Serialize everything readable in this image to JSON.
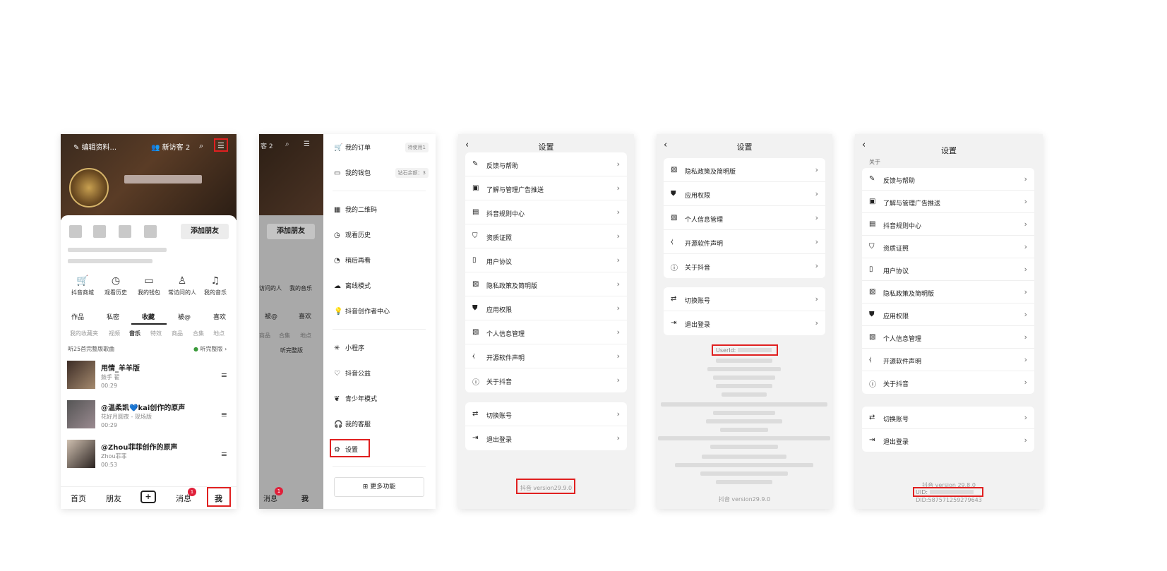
{
  "panel1": {
    "edit_profile": "编辑资料...",
    "new_visitors": "新访客 2",
    "add_friend": "添加朋友",
    "quick": [
      {
        "icon": "cart-icon",
        "label": "抖音商城"
      },
      {
        "icon": "clock-icon",
        "label": "观看历史"
      },
      {
        "icon": "wallet-icon",
        "label": "我的钱包"
      },
      {
        "icon": "person-icon",
        "label": "常访问的人"
      },
      {
        "icon": "music-icon",
        "label": "我的音乐"
      }
    ],
    "tabs": [
      "作品",
      "私密",
      "收藏",
      "被@",
      "喜欢"
    ],
    "subtabs": [
      "我的收藏夹",
      "视频",
      "音乐",
      "特效",
      "商品",
      "合集",
      "地点"
    ],
    "listen_text": "听25首完整版歌曲",
    "listen_full": "听完整版",
    "songs": [
      {
        "title": "用情_羊羊版",
        "artist": "鼓手 翟",
        "dur": "00:29"
      },
      {
        "title": "@温柔凯💙kai创作的原声",
        "artist": "花好月圆夜 - 现场版",
        "dur": "00:29"
      },
      {
        "title": "@Zhou菲菲创作的原声",
        "artist": "Zhou菲菲",
        "dur": "00:53"
      }
    ],
    "nav": [
      "首页",
      "朋友",
      "+",
      "消息",
      "我"
    ],
    "badge": "1"
  },
  "panel2": {
    "top_left": "客 2",
    "add_friend": "添加朋友",
    "quick": [
      "访问的人",
      "我的音乐"
    ],
    "tabs": [
      "被@",
      "喜欢"
    ],
    "subtabs": [
      "商品",
      "合集",
      "地点"
    ],
    "listen_full": "听完整版",
    "nav": [
      "消息",
      "我"
    ],
    "badge": "1",
    "items": [
      {
        "icon": "cart-icon",
        "label": "我的订单",
        "pill": "待使用1"
      },
      {
        "icon": "wallet-icon",
        "label": "我的钱包",
        "pill": "钻石余额：3"
      },
      {
        "icon": "qrcode-icon",
        "label": "我的二维码"
      },
      {
        "icon": "clock-icon",
        "label": "观看历史"
      },
      {
        "icon": "later-icon",
        "label": "稍后再看"
      },
      {
        "icon": "cloud-icon",
        "label": "离线模式"
      },
      {
        "icon": "bulb-icon",
        "label": "抖音创作者中心"
      },
      {
        "icon": "miniapp-icon",
        "label": "小程序"
      },
      {
        "icon": "heart-icon",
        "label": "抖音公益"
      },
      {
        "icon": "sprout-icon",
        "label": "青少年模式"
      },
      {
        "icon": "headset-icon",
        "label": "我的客服"
      },
      {
        "icon": "gear-icon",
        "label": "设置"
      }
    ],
    "more": "更多功能"
  },
  "panel3": {
    "title": "设置",
    "group1": [
      {
        "icon": "pencil-icon",
        "label": "反馈与帮助"
      },
      {
        "icon": "ad-icon",
        "label": "了解与管理广告推送"
      },
      {
        "icon": "rules-icon",
        "label": "抖音规则中心"
      },
      {
        "icon": "shield-check-icon",
        "label": "资质证照"
      },
      {
        "icon": "book-icon",
        "label": "用户协议"
      },
      {
        "icon": "privacy-icon",
        "label": "隐私政策及简明版"
      },
      {
        "icon": "shield-icon",
        "label": "应用权限"
      },
      {
        "icon": "profile-doc-icon",
        "label": "个人信息管理"
      },
      {
        "icon": "code-icon",
        "label": "开源软件声明"
      },
      {
        "icon": "info-icon",
        "label": "关于抖音"
      }
    ],
    "group2": [
      {
        "icon": "switch-icon",
        "label": "切换账号"
      },
      {
        "icon": "logout-icon",
        "label": "退出登录"
      }
    ],
    "version": "抖音 version29.9.0"
  },
  "panel4": {
    "title": "设置",
    "group1": [
      {
        "icon": "privacy-icon",
        "label": "隐私政策及简明版"
      },
      {
        "icon": "shield-icon",
        "label": "应用权限"
      },
      {
        "icon": "profile-doc-icon",
        "label": "个人信息管理"
      },
      {
        "icon": "code-icon",
        "label": "开源软件声明"
      },
      {
        "icon": "info-icon",
        "label": "关于抖音"
      }
    ],
    "group2": [
      {
        "icon": "switch-icon",
        "label": "切换账号"
      },
      {
        "icon": "logout-icon",
        "label": "退出登录"
      }
    ],
    "userid_label": "UserId:",
    "version": "抖音 version29.9.0"
  },
  "panel5": {
    "title": "设置",
    "section": "关于",
    "group1": [
      {
        "icon": "pencil-icon",
        "label": "反馈与帮助"
      },
      {
        "icon": "ad-icon",
        "label": "了解与管理广告推送"
      },
      {
        "icon": "rules-icon",
        "label": "抖音规则中心"
      },
      {
        "icon": "shield-check-icon",
        "label": "资质证照"
      },
      {
        "icon": "book-icon",
        "label": "用户协议"
      },
      {
        "icon": "privacy-icon",
        "label": "隐私政策及简明版"
      },
      {
        "icon": "shield-icon",
        "label": "应用权限"
      },
      {
        "icon": "profile-doc-icon",
        "label": "个人信息管理"
      },
      {
        "icon": "code-icon",
        "label": "开源软件声明"
      },
      {
        "icon": "info-icon",
        "label": "关于抖音"
      }
    ],
    "group2": [
      {
        "icon": "switch-icon",
        "label": "切换账号"
      },
      {
        "icon": "logout-icon",
        "label": "退出登录"
      }
    ],
    "version": "抖音 version 29.8.0",
    "uid_label": "UID:",
    "did": "DID:587571259279643"
  },
  "colors": {
    "highlight": "#e02020",
    "background": "#f2f2f2",
    "badge": "#e0203a"
  }
}
